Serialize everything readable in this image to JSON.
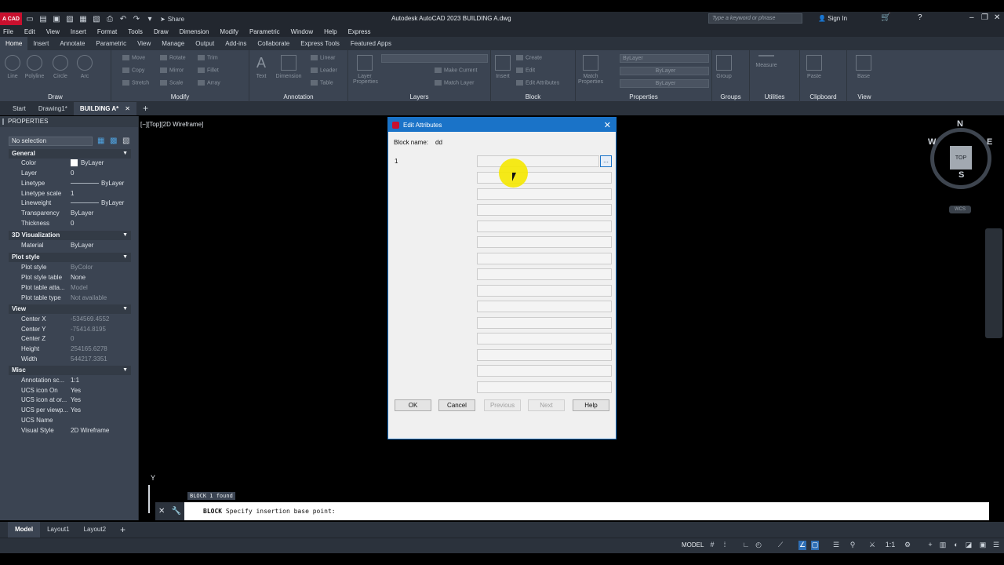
{
  "title_bar": {
    "app_logo": "A CAD",
    "share": "Share",
    "window_title": "Autodesk AutoCAD 2023    BUILDING A.dwg",
    "search_placeholder": "Type a keyword or phrase",
    "sign_in": "Sign In"
  },
  "menu": [
    "File",
    "Edit",
    "View",
    "Insert",
    "Format",
    "Tools",
    "Draw",
    "Dimension",
    "Modify",
    "Parametric",
    "Window",
    "Help",
    "Express"
  ],
  "ribbon_tabs": [
    "Home",
    "Insert",
    "Annotate",
    "Parametric",
    "View",
    "Manage",
    "Output",
    "Add-ins",
    "Collaborate",
    "Express Tools",
    "Featured Apps"
  ],
  "ribbon": {
    "draw": {
      "title": "Draw",
      "line": "Line",
      "polyline": "Polyline",
      "circle": "Circle",
      "arc": "Arc"
    },
    "modify": {
      "title": "Modify",
      "move": "Move",
      "rotate": "Rotate",
      "trim": "Trim",
      "copy": "Copy",
      "mirror": "Mirror",
      "fillet": "Fillet",
      "stretch": "Stretch",
      "scale": "Scale",
      "array": "Array"
    },
    "annotation": {
      "title": "Annotation",
      "text": "Text",
      "dimension": "Dimension",
      "linear": "Linear",
      "leader": "Leader",
      "table": "Table"
    },
    "layers": {
      "title": "Layers",
      "layer_properties": "Layer Properties",
      "make_current": "Make Current",
      "match_layer": "Match Layer"
    },
    "block": {
      "title": "Block",
      "insert": "Insert",
      "create": "Create",
      "edit": "Edit",
      "edit_attributes": "Edit Attributes"
    },
    "properties": {
      "title": "Properties",
      "match_properties": "Match Properties",
      "bylayer_1": "ByLayer",
      "bylayer_2": "ByLayer",
      "bylayer_3": "ByLayer"
    },
    "groups": {
      "title": "Groups",
      "group": "Group"
    },
    "utilities": {
      "title": "Utilities",
      "measure": "Measure"
    },
    "clipboard": {
      "title": "Clipboard",
      "paste": "Paste"
    },
    "view": {
      "title": "View",
      "base": "Base"
    }
  },
  "file_tabs": {
    "start": "Start",
    "drawing1": "Drawing1*",
    "building": "BUILDING A*"
  },
  "properties_palette": {
    "title": "PROPERTIES",
    "selection": "No selection",
    "sections": {
      "general": "General",
      "viz3d": "3D Visualization",
      "plot": "Plot style",
      "view": "View",
      "misc": "Misc"
    },
    "rows": [
      {
        "name": "Color",
        "value": "ByLayer"
      },
      {
        "name": "Layer",
        "value": "0"
      },
      {
        "name": "Linetype",
        "value": "ByLayer"
      },
      {
        "name": "Linetype scale",
        "value": "1"
      },
      {
        "name": "Lineweight",
        "value": "ByLayer"
      },
      {
        "name": "Transparency",
        "value": "ByLayer"
      },
      {
        "name": "Thickness",
        "value": "0"
      },
      {
        "name": "Material",
        "value": "ByLayer"
      },
      {
        "name": "Plot style",
        "value": "ByColor"
      },
      {
        "name": "Plot style table",
        "value": "None"
      },
      {
        "name": "Plot table atta...",
        "value": "Model"
      },
      {
        "name": "Plot table type",
        "value": "Not available"
      },
      {
        "name": "Center X",
        "value": "-534569.4552"
      },
      {
        "name": "Center Y",
        "value": "-75414.8195"
      },
      {
        "name": "Center Z",
        "value": "0"
      },
      {
        "name": "Height",
        "value": "254165.6278"
      },
      {
        "name": "Width",
        "value": "544217.3351"
      },
      {
        "name": "Annotation sc...",
        "value": "1:1"
      },
      {
        "name": "UCS icon On",
        "value": "Yes"
      },
      {
        "name": "UCS icon at or...",
        "value": "Yes"
      },
      {
        "name": "UCS per viewp...",
        "value": "Yes"
      },
      {
        "name": "UCS Name",
        "value": ""
      },
      {
        "name": "Visual Style",
        "value": "2D Wireframe"
      }
    ]
  },
  "viewport": {
    "label": "[−][Top][2D Wireframe]",
    "viewcube_top": "TOP",
    "north": "N",
    "south": "S",
    "east": "E",
    "west": "W",
    "ucs": "WCS",
    "y_axis": "Y"
  },
  "command": {
    "history": "BLOCK 1 found",
    "keyword": "BLOCK",
    "prompt": "Specify insertion base point:"
  },
  "layout_tabs": [
    "Model",
    "Layout1",
    "Layout2"
  ],
  "status": {
    "model": "MODEL",
    "scale": "1:1"
  },
  "dialog": {
    "title": "Edit Attributes",
    "block_name_label": "Block name:",
    "block_name": "dd",
    "attribute_prompt": "1",
    "attribute_value": "",
    "browse": "...",
    "buttons": {
      "ok": "OK",
      "cancel": "Cancel",
      "previous": "Previous",
      "next": "Next",
      "help": "Help"
    }
  }
}
